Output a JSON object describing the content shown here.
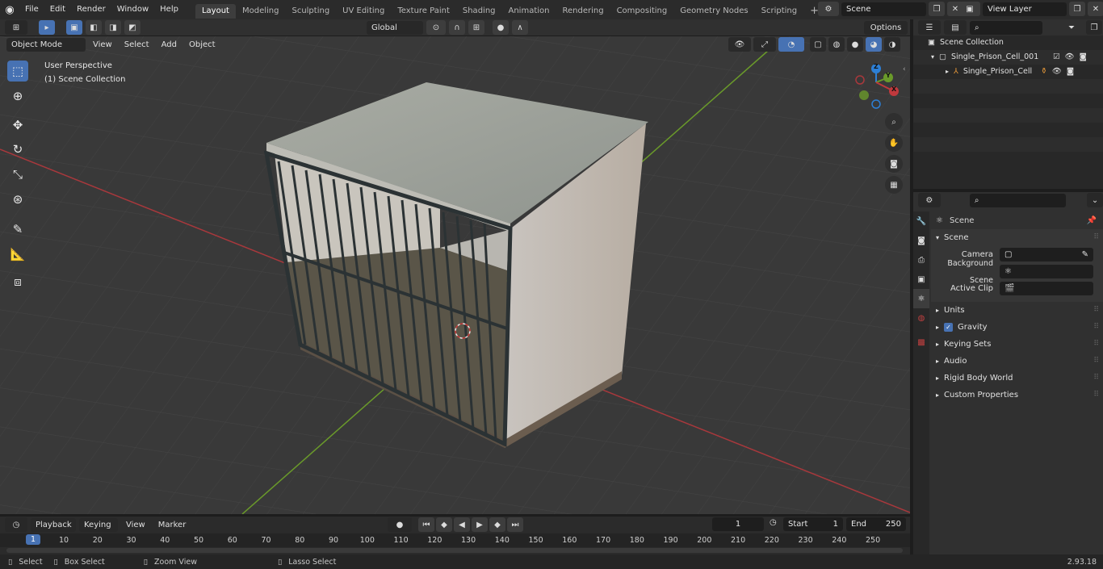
{
  "menu": {
    "items": [
      "File",
      "Edit",
      "Render",
      "Window",
      "Help"
    ]
  },
  "workspaces": [
    "Layout",
    "Modeling",
    "Sculpting",
    "UV Editing",
    "Texture Paint",
    "Shading",
    "Animation",
    "Rendering",
    "Compositing",
    "Geometry Nodes",
    "Scripting"
  ],
  "scene_field": "Scene",
  "view_layer_field": "View Layer",
  "viewport_header": {
    "mode": "Object Mode",
    "menus": [
      "View",
      "Select",
      "Add",
      "Object"
    ],
    "transform_orientation": "Global",
    "options": "Options"
  },
  "viewport_overlay": {
    "perspective": "User Perspective",
    "collection": "(1) Scene Collection"
  },
  "gizmo": {
    "z": "Z",
    "y": "Y",
    "x": "X"
  },
  "outliner": {
    "root": "Scene Collection",
    "items": [
      {
        "label": "Single_Prison_Cell_001",
        "depth": 1
      },
      {
        "label": "Single_Prison_Cell",
        "depth": 2
      }
    ]
  },
  "properties": {
    "header": "Scene",
    "section": "Scene",
    "fields": [
      {
        "label": "Camera",
        "value": ""
      },
      {
        "label": "Background Scene",
        "value": ""
      },
      {
        "label": "Active Clip",
        "value": ""
      }
    ],
    "panels": [
      "Units",
      "Gravity",
      "Keying Sets",
      "Audio",
      "Rigid Body World",
      "Custom Properties"
    ]
  },
  "timeline": {
    "menus": [
      "Playback",
      "Keying",
      "View",
      "Marker"
    ],
    "current_frame": "1",
    "start_label": "Start",
    "start": "1",
    "end_label": "End",
    "end": "250",
    "ruler": [
      "1",
      "10",
      "20",
      "30",
      "40",
      "50",
      "60",
      "70",
      "80",
      "90",
      "100",
      "110",
      "120",
      "130",
      "140",
      "150",
      "160",
      "170",
      "180",
      "190",
      "200",
      "210",
      "220",
      "230",
      "240",
      "250"
    ]
  },
  "statusbar": {
    "select": "Select",
    "box_select": "Box Select",
    "zoom_view": "Zoom View",
    "lasso_select": "Lasso Select",
    "version": "2.93.18"
  },
  "colors": {
    "accent": "#4772b3",
    "x_axis": "#c0393d",
    "y_axis": "#6a9a2a",
    "z_axis": "#2d7fd6"
  }
}
